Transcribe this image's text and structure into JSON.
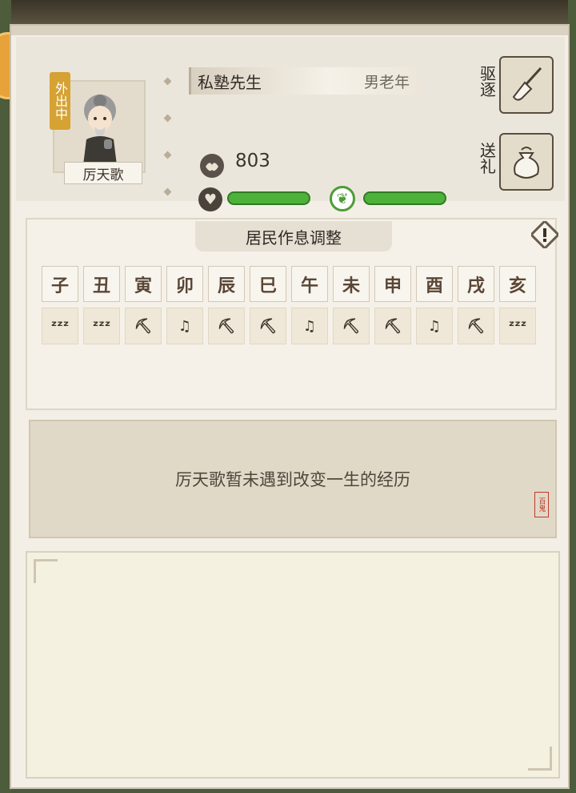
{
  "resident": {
    "status_tag": "外出中",
    "name": "厉天歌",
    "title": "私塾先生",
    "gender_age": "男老年",
    "coins": "803",
    "health_fraction": 1.0,
    "mood_fraction": 1.0
  },
  "actions": {
    "expel_label": "驱逐",
    "gift_label": "送礼"
  },
  "schedule": {
    "title": "居民作息调整",
    "hours": [
      "子",
      "丑",
      "寅",
      "卯",
      "辰",
      "巳",
      "午",
      "未",
      "申",
      "酉",
      "戌",
      "亥"
    ],
    "activities": [
      "sleep",
      "sleep",
      "work",
      "leisure",
      "work",
      "work",
      "leisure",
      "work",
      "work",
      "leisure",
      "work",
      "sleep"
    ],
    "activity_glyphs": {
      "sleep": "ᶻᶻᶻ",
      "work": "⛏",
      "leisure": "♫"
    }
  },
  "event": {
    "text": "厉天歌暂未遇到改变一生的经历",
    "seal_text": "百鬼"
  },
  "colors": {
    "bar_green": "#4db23a",
    "panel_bg": "#f3efe6",
    "badge_gold": "#d5a233"
  }
}
